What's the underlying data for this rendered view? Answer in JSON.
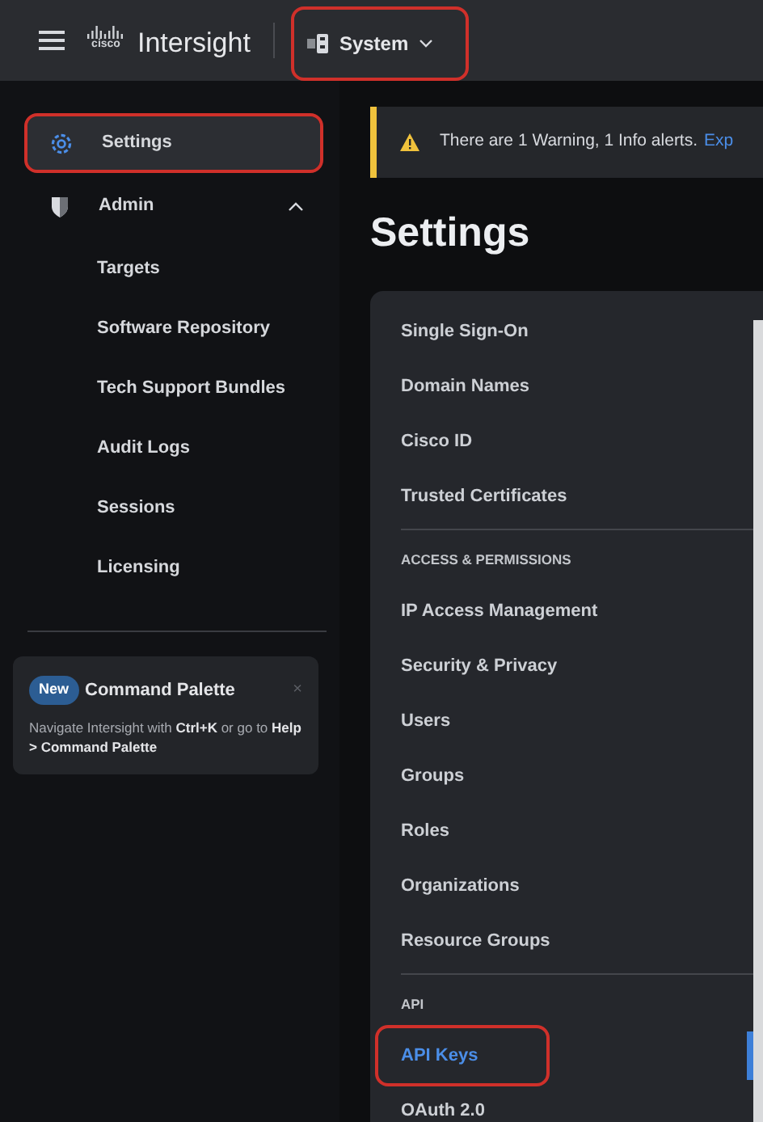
{
  "top_bar": {
    "logo_text": "cisco",
    "brand": "Intersight",
    "scope": {
      "label": "System",
      "highlighted": true
    }
  },
  "sidebar": {
    "items": [
      {
        "kind": "gear",
        "label": "Settings",
        "selected": true,
        "highlighted": true
      },
      {
        "kind": "shield",
        "label": "Admin",
        "selected": false,
        "expanded": true,
        "children": [
          {
            "label": "Targets",
            "selected": false
          },
          {
            "label": "Software Repository",
            "selected": false
          },
          {
            "label": "Tech Support Bundles",
            "selected": false
          },
          {
            "label": "Audit Logs",
            "selected": false
          },
          {
            "label": "Sessions",
            "selected": false
          },
          {
            "label": "Licensing",
            "selected": false
          }
        ]
      }
    ]
  },
  "promo": {
    "badge": "New",
    "title": "Command Palette",
    "close": "×",
    "text": "Navigate Intersight with **Ctrl+K** or go to **Help > Command Palette**"
  },
  "alert": {
    "text": "There are 1 Warning, 1 Info alerts.",
    "link": "Exp"
  },
  "page_title": "Settings",
  "settings_menu": [
    {
      "items": [
        {
          "label": "Single Sign-On",
          "selected": false,
          "highlighted": false
        },
        {
          "label": "Domain Names",
          "selected": false,
          "highlighted": false
        },
        {
          "label": "Cisco ID",
          "selected": false,
          "highlighted": false
        },
        {
          "label": "Trusted Certificates",
          "selected": false,
          "highlighted": false
        }
      ]
    },
    {
      "heading": "ACCESS & PERMISSIONS",
      "items": [
        {
          "label": "IP Access Management",
          "selected": false,
          "highlighted": false
        },
        {
          "label": "Security & Privacy",
          "selected": false,
          "highlighted": false
        },
        {
          "label": "Users",
          "selected": false,
          "highlighted": false
        },
        {
          "label": "Groups",
          "selected": false,
          "highlighted": false
        },
        {
          "label": "Roles",
          "selected": false,
          "highlighted": false
        },
        {
          "label": "Organizations",
          "selected": false,
          "highlighted": false
        },
        {
          "label": "Resource Groups",
          "selected": false,
          "highlighted": false
        }
      ]
    },
    {
      "heading": "API",
      "items": [
        {
          "label": "API Keys",
          "selected": true,
          "highlighted": true
        },
        {
          "label": "OAuth 2.0",
          "selected": false,
          "highlighted": false
        }
      ]
    }
  ]
}
